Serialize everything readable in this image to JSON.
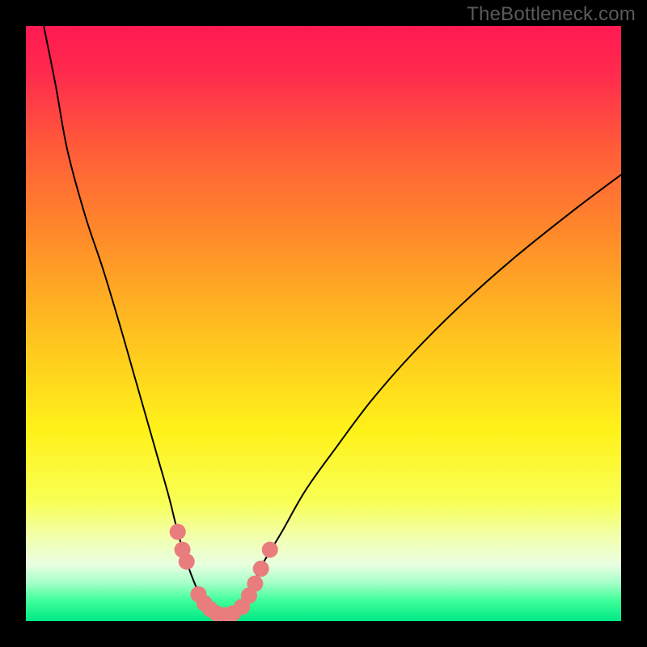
{
  "watermark": "TheBottleneck.com",
  "chart_data": {
    "type": "line",
    "title": "",
    "xlabel": "",
    "ylabel": "",
    "xlim": [
      0,
      100
    ],
    "ylim": [
      0,
      100
    ],
    "gradient_stops": [
      {
        "offset": 0.0,
        "color": "#ff1a52"
      },
      {
        "offset": 0.08,
        "color": "#ff2a4d"
      },
      {
        "offset": 0.2,
        "color": "#ff5a3a"
      },
      {
        "offset": 0.35,
        "color": "#ff8a2a"
      },
      {
        "offset": 0.52,
        "color": "#ffc21f"
      },
      {
        "offset": 0.68,
        "color": "#fff21a"
      },
      {
        "offset": 0.8,
        "color": "#f8ff55"
      },
      {
        "offset": 0.86,
        "color": "#f2ffb0"
      },
      {
        "offset": 0.905,
        "color": "#e8ffe0"
      },
      {
        "offset": 0.935,
        "color": "#a8ffc8"
      },
      {
        "offset": 0.965,
        "color": "#40ff9a"
      },
      {
        "offset": 1.0,
        "color": "#00e884"
      }
    ],
    "series": [
      {
        "name": "bottleneck-curve",
        "color": "#000000",
        "stroke_width": 2,
        "x": [
          3,
          5,
          7,
          10,
          13,
          16,
          18,
          20,
          22,
          24,
          25.5,
          27,
          28.5,
          30,
          31.5,
          33,
          34.5,
          36,
          38,
          40,
          43,
          47,
          52,
          58,
          65,
          73,
          82,
          92,
          100
        ],
        "values": [
          100,
          90,
          79,
          68,
          59,
          49,
          42,
          35,
          28,
          21,
          15,
          10,
          6,
          3,
          1.5,
          1,
          1.5,
          3,
          6,
          10,
          15,
          22,
          29,
          37,
          45,
          53,
          61,
          69,
          75
        ]
      }
    ],
    "markers": {
      "name": "bead-markers",
      "color": "#e97c7c",
      "radius": 10,
      "points": [
        {
          "x": 25.5,
          "y": 15
        },
        {
          "x": 26.3,
          "y": 12
        },
        {
          "x": 27.0,
          "y": 10
        },
        {
          "x": 29.0,
          "y": 4.5
        },
        {
          "x": 30.0,
          "y": 3.0
        },
        {
          "x": 31.0,
          "y": 2.0
        },
        {
          "x": 32.0,
          "y": 1.3
        },
        {
          "x": 33.5,
          "y": 1.0
        },
        {
          "x": 34.8,
          "y": 1.3
        },
        {
          "x": 36.3,
          "y": 2.4
        },
        {
          "x": 37.5,
          "y": 4.3
        },
        {
          "x": 38.5,
          "y": 6.3
        },
        {
          "x": 39.5,
          "y": 8.8
        },
        {
          "x": 41.0,
          "y": 12.0
        }
      ]
    }
  }
}
